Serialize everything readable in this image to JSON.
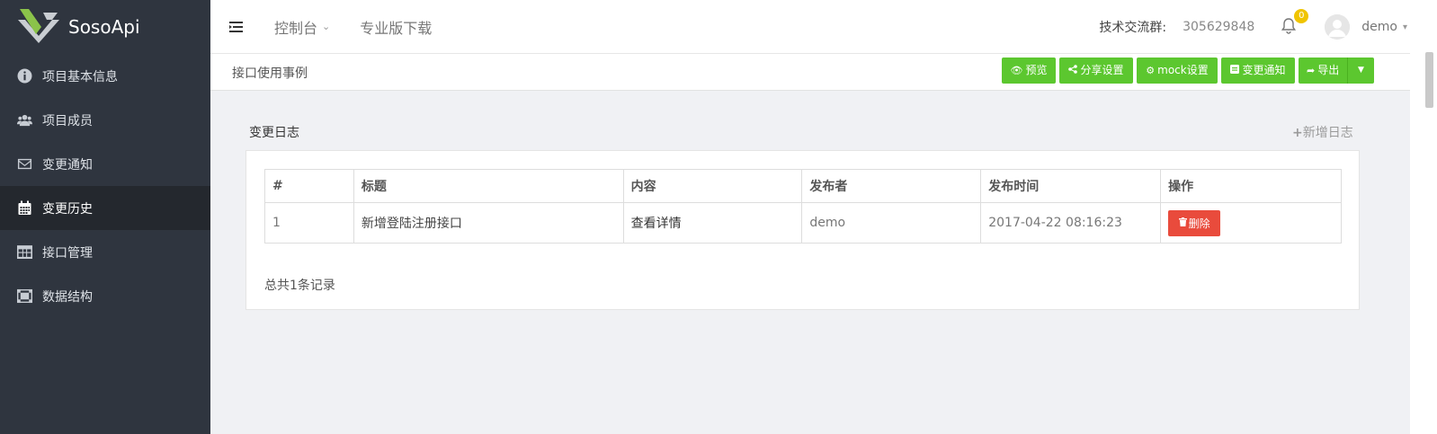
{
  "app": {
    "name": "SosoApi"
  },
  "sidebar": {
    "items": [
      {
        "label": "项目基本信息",
        "icon": "info-circle-icon",
        "active": false
      },
      {
        "label": "项目成员",
        "icon": "users-icon",
        "active": false
      },
      {
        "label": "变更通知",
        "icon": "envelope-icon",
        "active": false
      },
      {
        "label": "变更历史",
        "icon": "calendar-icon",
        "active": true
      },
      {
        "label": "接口管理",
        "icon": "table-icon",
        "active": false
      },
      {
        "label": "数据结构",
        "icon": "structure-icon",
        "active": false
      }
    ]
  },
  "topbar": {
    "console_label": "控制台",
    "pro_download_label": "专业版下载",
    "qq_group_label": "技术交流群:",
    "qq_group_value": "305629848",
    "notification_count": "0",
    "username": "demo"
  },
  "subheader": {
    "title": "接口使用事例",
    "buttons": {
      "preview": "预览",
      "share": "分享设置",
      "mock": "mock设置",
      "notify": "变更通知",
      "export": "导出"
    }
  },
  "content": {
    "section_title": "变更日志",
    "add_log_label": "新增日志",
    "table": {
      "headers": [
        "#",
        "标题",
        "内容",
        "发布者",
        "发布时间",
        "操作"
      ],
      "rows": [
        {
          "id": "1",
          "title": "新增登陆注册接口",
          "content": "查看详情",
          "publisher": "demo",
          "time": "2017-04-22 08:16:23",
          "action": "删除"
        }
      ]
    },
    "total_text": "总共1条记录"
  },
  "colors": {
    "sidebar_bg": "#2f353f",
    "sidebar_active_bg": "#24282e",
    "green": "#5cc72f",
    "red": "#e94b3c",
    "badge": "#f0c400"
  }
}
